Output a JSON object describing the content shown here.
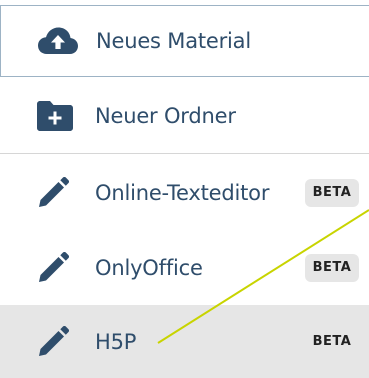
{
  "menu": {
    "items": [
      {
        "label": "Neues Material",
        "icon": "cloud-upload-icon"
      },
      {
        "label": "Neuer Ordner",
        "icon": "folder-plus-icon"
      },
      {
        "label": "Online-Texteditor",
        "icon": "pencil-icon",
        "badge": "BETA"
      },
      {
        "label": "OnlyOffice",
        "icon": "pencil-icon",
        "badge": "BETA"
      },
      {
        "label": "H5P",
        "icon": "pencil-icon",
        "badge": "BETA"
      }
    ]
  },
  "colors": {
    "icon": "#2f4d6b",
    "text": "#2f4d6b",
    "selected_background": "#e6e6e6",
    "badge_background": "#e6e6e6",
    "annotation_line": "#c8d400",
    "border": "#9db3c5"
  }
}
